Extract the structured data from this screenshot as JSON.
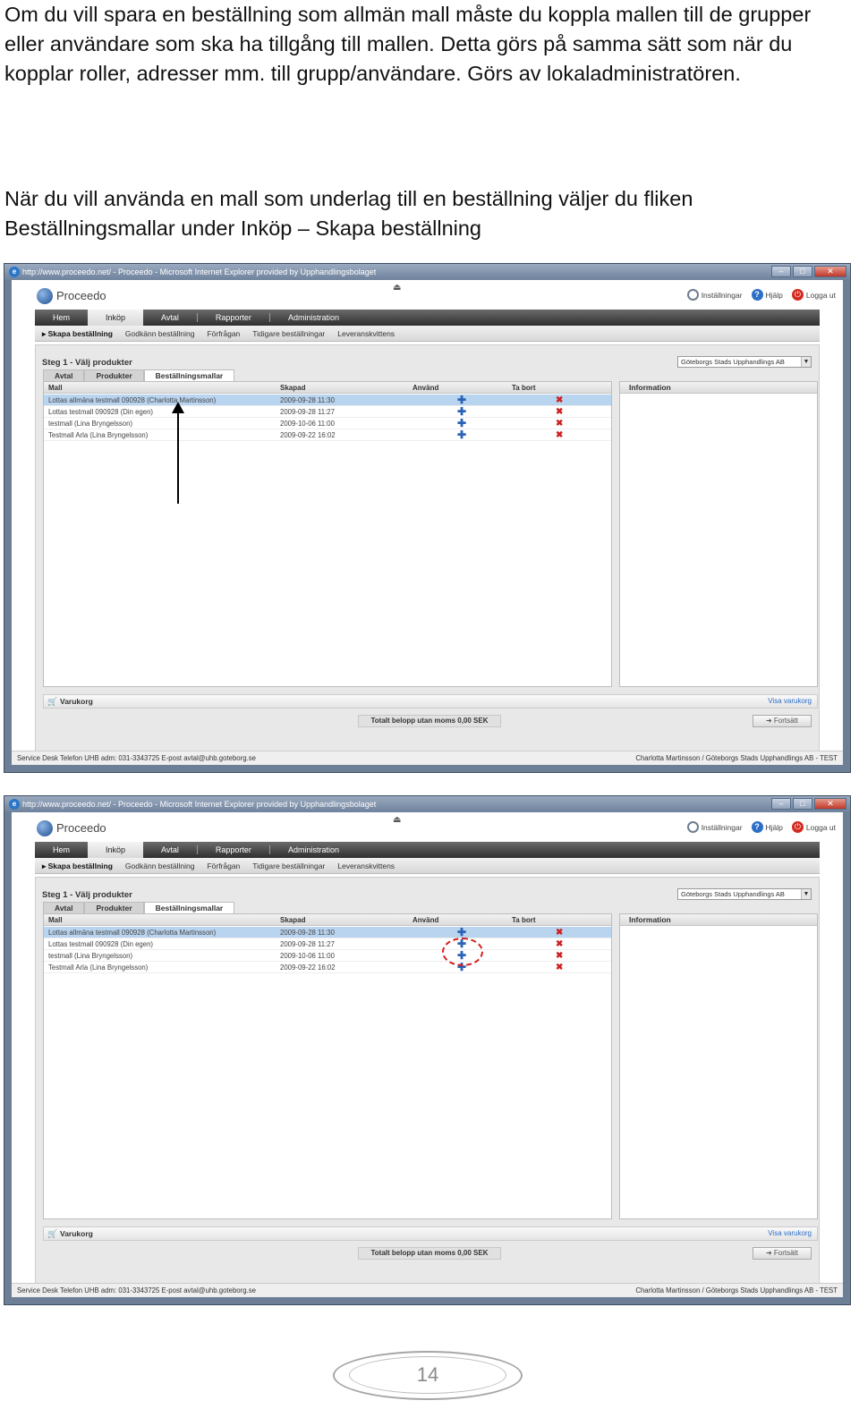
{
  "document": {
    "paragraph1": "Om du vill spara en beställning som allmän mall måste du koppla mallen till de grupper eller användare som ska ha tillgång till mallen. Detta görs på samma sätt som när du kopplar roller, adresser mm. till grupp/användare. Görs av lokaladministratören.",
    "paragraph2": "När du vill använda en mall som underlag till en beställning väljer du fliken Beställningsmallar under Inköp – Skapa beställning",
    "page_number": "14"
  },
  "screenshot": {
    "window_title": "http://www.proceedo.net/ - Proceedo - Microsoft Internet Explorer provided by Upphandlingsbolaget",
    "window_buttons": {
      "min": "–",
      "max": "□",
      "close": "✕"
    },
    "brand": "Proceedo",
    "top_links": {
      "settings": "Inställningar",
      "help": "Hjälp",
      "logout": "Logga ut"
    },
    "nav": [
      "Hem",
      "Inköp",
      "Avtal",
      "Rapporter",
      "Administration"
    ],
    "subnav": [
      "Skapa beställning",
      "Godkänn beställning",
      "Förfrågan",
      "Tidigare beställningar",
      "Leveranskvittens"
    ],
    "step_title": "Steg 1 - Välj produkter",
    "org_select": "Göteborgs Stads Upphandlings AB",
    "panel_tabs": [
      "Avtal",
      "Produkter",
      "Beställningsmallar"
    ],
    "columns": {
      "mall": "Mall",
      "skapad": "Skapad",
      "anvand": "Använd",
      "tabort": "Ta bort"
    },
    "rows": [
      {
        "mall": "Lottas allmäna testmall 090928 (Charlotta Martinsson)",
        "skapad": "2009-09-28 11:30"
      },
      {
        "mall": "Lottas testmall 090928 (Din egen)",
        "skapad": "2009-09-28 11:27"
      },
      {
        "mall": "testmall (Lina Bryngelsson)",
        "skapad": "2009-10-06 11:00"
      },
      {
        "mall": "Testmall Arla (Lina Bryngelsson)",
        "skapad": "2009-09-22 16:02"
      }
    ],
    "info_title": "Information",
    "cart_label": "Varukorg",
    "cart_link": "Visa varukorg",
    "total": "Totalt belopp utan moms    0,00 SEK",
    "continue": "Fortsätt",
    "status_left": "Service Desk Telefon UHB adm: 031-3343725   E-post avtal@uhb.goteborg.se",
    "status_right": "Charlotta Martinsson / Göteborgs Stads Upphandlings AB - TEST",
    "icons": {
      "use": "plus-icon",
      "delete": "cross-icon",
      "arrow": "arrow-annotation",
      "highlight": "dashed-circle-annotation"
    }
  }
}
